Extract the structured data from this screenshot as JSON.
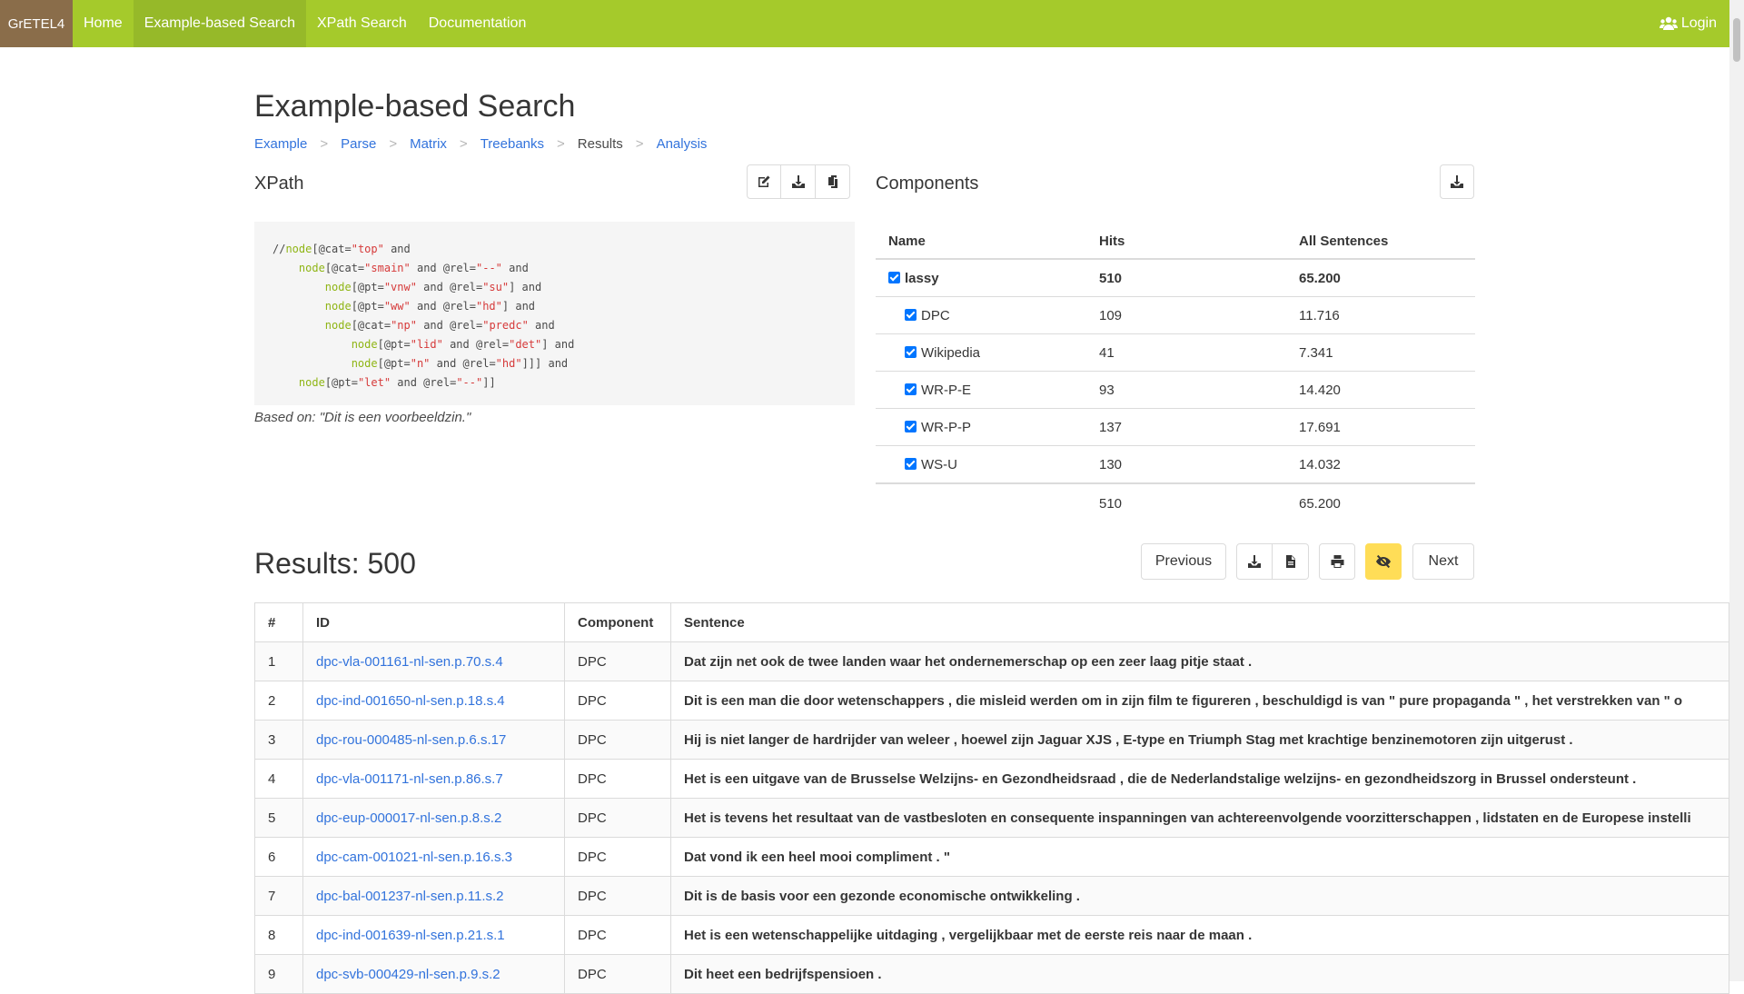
{
  "navbar": {
    "brand": "GrETEL4",
    "items": [
      {
        "label": "Home",
        "active": false
      },
      {
        "label": "Example-based Search",
        "active": true
      },
      {
        "label": "XPath Search",
        "active": false
      },
      {
        "label": "Documentation",
        "active": false
      }
    ],
    "login": "Login"
  },
  "page": {
    "title": "Example-based Search"
  },
  "breadcrumb": {
    "steps": [
      "Example",
      "Parse",
      "Matrix",
      "Treebanks",
      "Results",
      "Analysis"
    ],
    "current": "Results"
  },
  "xpath": {
    "title": "XPath",
    "based_on": "Based on: \"Dit is een voorbeeldzin.\""
  },
  "components": {
    "title": "Components",
    "headers": [
      "Name",
      "Hits",
      "All Sentences"
    ],
    "rows": [
      {
        "name": "lassy",
        "hits": "510",
        "all": "65.200",
        "checked": true
      },
      {
        "name": "DPC",
        "hits": "109",
        "all": "11.716",
        "checked": true
      },
      {
        "name": "Wikipedia",
        "hits": "41",
        "all": "7.341",
        "checked": true
      },
      {
        "name": "WR-P-E",
        "hits": "93",
        "all": "14.420",
        "checked": true
      },
      {
        "name": "WR-P-P",
        "hits": "137",
        "all": "17.691",
        "checked": true
      },
      {
        "name": "WS-U",
        "hits": "130",
        "all": "14.032",
        "checked": true
      }
    ],
    "total": {
      "hits": "510",
      "all": "65.200"
    }
  },
  "results": {
    "title": "Results: 500",
    "previous": "Previous",
    "next": "Next",
    "headers": [
      "#",
      "ID",
      "Component",
      "Sentence"
    ],
    "rows": [
      {
        "n": "1",
        "id": "dpc-vla-001161-nl-sen.p.70.s.4",
        "component": "DPC",
        "sentence": "Dat zijn net ook de twee landen waar het ondernemerschap op een zeer laag pitje staat ."
      },
      {
        "n": "2",
        "id": "dpc-ind-001650-nl-sen.p.18.s.4",
        "component": "DPC",
        "sentence": "Dit is een man die door wetenschappers , die misleid werden om in zijn film te figureren , beschuldigd is van \" pure propaganda \" , het verstrekken van \" o"
      },
      {
        "n": "3",
        "id": "dpc-rou-000485-nl-sen.p.6.s.17",
        "component": "DPC",
        "sentence": "Hij is niet langer de hardrijder van weleer , hoewel zijn Jaguar XJS , E-type en Triumph Stag met krachtige benzinemotoren zijn uitgerust ."
      },
      {
        "n": "4",
        "id": "dpc-vla-001171-nl-sen.p.86.s.7",
        "component": "DPC",
        "sentence": "Het is een uitgave van de Brusselse Welzijns- en Gezondheidsraad , die de Nederlandstalige welzijns- en gezondheidszorg in Brussel ondersteunt ."
      },
      {
        "n": "5",
        "id": "dpc-eup-000017-nl-sen.p.8.s.2",
        "component": "DPC",
        "sentence": "Het is tevens het resultaat van de vastbesloten en consequente inspanningen van achtereenvolgende voorzitterschappen , lidstaten en de Europese instelli"
      },
      {
        "n": "6",
        "id": "dpc-cam-001021-nl-sen.p.16.s.3",
        "component": "DPC",
        "sentence": "Dat vond ik een heel mooi compliment . \""
      },
      {
        "n": "7",
        "id": "dpc-bal-001237-nl-sen.p.11.s.2",
        "component": "DPC",
        "sentence": "Dit is de basis voor een gezonde economische ontwikkeling ."
      },
      {
        "n": "8",
        "id": "dpc-ind-001639-nl-sen.p.21.s.1",
        "component": "DPC",
        "sentence": "Het is een wetenschappelijke uitdaging , vergelijkbaar met de eerste reis naar de maan ."
      },
      {
        "n": "9",
        "id": "dpc-svb-000429-nl-sen.p.9.s.2",
        "component": "DPC",
        "sentence": "Dit heet een bedrijfspensioen ."
      }
    ]
  }
}
